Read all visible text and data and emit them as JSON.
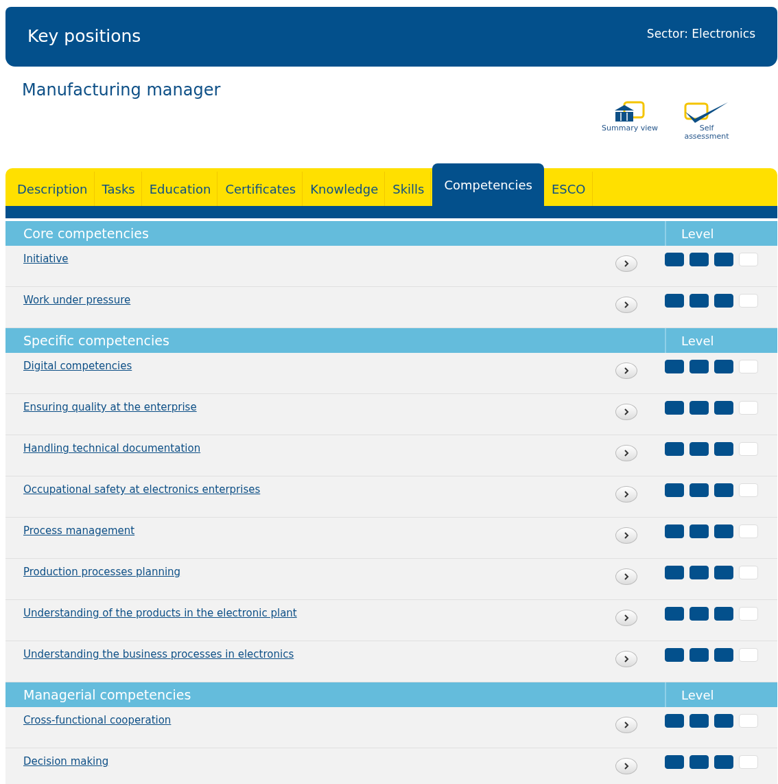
{
  "header": {
    "title": "Key positions",
    "sector": "Sector: Electronics"
  },
  "position": {
    "title": "Manufacturing manager"
  },
  "actions": [
    {
      "kind": "summary",
      "label": "Summary view"
    },
    {
      "kind": "self",
      "label": "Self assessment"
    }
  ],
  "tabs": [
    {
      "label": "Description",
      "selected": false
    },
    {
      "label": "Tasks",
      "selected": false
    },
    {
      "label": "Education",
      "selected": false
    },
    {
      "label": "Certificates",
      "selected": false
    },
    {
      "label": "Knowledge",
      "selected": false
    },
    {
      "label": "Skills",
      "selected": false
    },
    {
      "label": "Competencies",
      "selected": true
    },
    {
      "label": "ESCO",
      "selected": false
    }
  ],
  "sections": [
    {
      "title": "Core competencies",
      "level_header": "Level",
      "rows": [
        {
          "name": "Initiative",
          "stars": 3
        },
        {
          "name": "Work under pressure",
          "stars": 3
        }
      ]
    },
    {
      "title": "Specific competencies",
      "level_header": "Level",
      "rows": [
        {
          "name": "Digital competencies",
          "stars": 3
        },
        {
          "name": "Ensuring quality at the enterprise",
          "stars": 3
        },
        {
          "name": "Handling technical documentation",
          "stars": 3
        },
        {
          "name": "Occupational safety at electronics enterprises",
          "stars": 3
        },
        {
          "name": "Process management",
          "stars": 3
        },
        {
          "name": "Production processes planning",
          "stars": 3
        },
        {
          "name": "Understanding of the products in the electronic plant",
          "stars": 3
        },
        {
          "name": "Understanding the business processes in electronics",
          "stars": 3
        }
      ]
    },
    {
      "title": "Managerial competencies",
      "level_header": "Level",
      "rows": [
        {
          "name": "Cross-functional cooperation",
          "stars": 3
        },
        {
          "name": "Decision making",
          "stars": 3
        }
      ]
    }
  ]
}
